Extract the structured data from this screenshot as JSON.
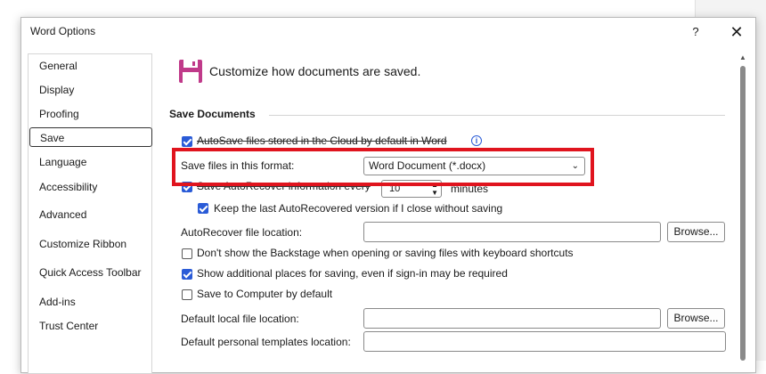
{
  "window": {
    "title": "Word Options",
    "help_label": "?",
    "close_label": "✕"
  },
  "sidebar": {
    "items": [
      {
        "label": "General"
      },
      {
        "label": "Display"
      },
      {
        "label": "Proofing"
      },
      {
        "label": "Save",
        "selected": true
      },
      {
        "label": "Language"
      },
      {
        "label": "Accessibility"
      },
      {
        "label": "Advanced"
      },
      {
        "label": "Customize Ribbon"
      },
      {
        "label": "Quick Access Toolbar"
      },
      {
        "label": "Add-ins"
      },
      {
        "label": "Trust Center"
      }
    ]
  },
  "header": {
    "icon": "save-floppy-icon",
    "text": "Customize how documents are saved."
  },
  "section": {
    "title": "Save Documents"
  },
  "options": {
    "autosave_label": "AutoSave files stored in the Cloud by default in Word",
    "autosave_checked": true,
    "format_label": "Save files in this format:",
    "format_value": "Word Document (*.docx)",
    "autorecover_label": "Save AutoRecover information every",
    "autorecover_checked": true,
    "autorecover_minutes": "10",
    "minutes_label": "minutes",
    "keep_last_label": "Keep the last AutoRecovered version if I close without saving",
    "keep_last_checked": true,
    "autorecover_location_label": "AutoRecover file location:",
    "autorecover_location_value": "",
    "browse_label": "Browse...",
    "backstage_label": "Don't show the Backstage when opening or saving files with keyboard shortcuts",
    "backstage_checked": false,
    "additional_places_label": "Show additional places for saving, even if sign-in may be required",
    "additional_places_checked": true,
    "save_to_computer_label": "Save to Computer by default",
    "save_to_computer_checked": false,
    "default_local_label": "Default local file location:",
    "default_local_value": "",
    "default_templates_label": "Default personal templates location:",
    "default_templates_value": ""
  },
  "colors": {
    "accent": "#2a5bd7",
    "highlight": "#e0141e",
    "save_icon": "#c03a8a"
  }
}
